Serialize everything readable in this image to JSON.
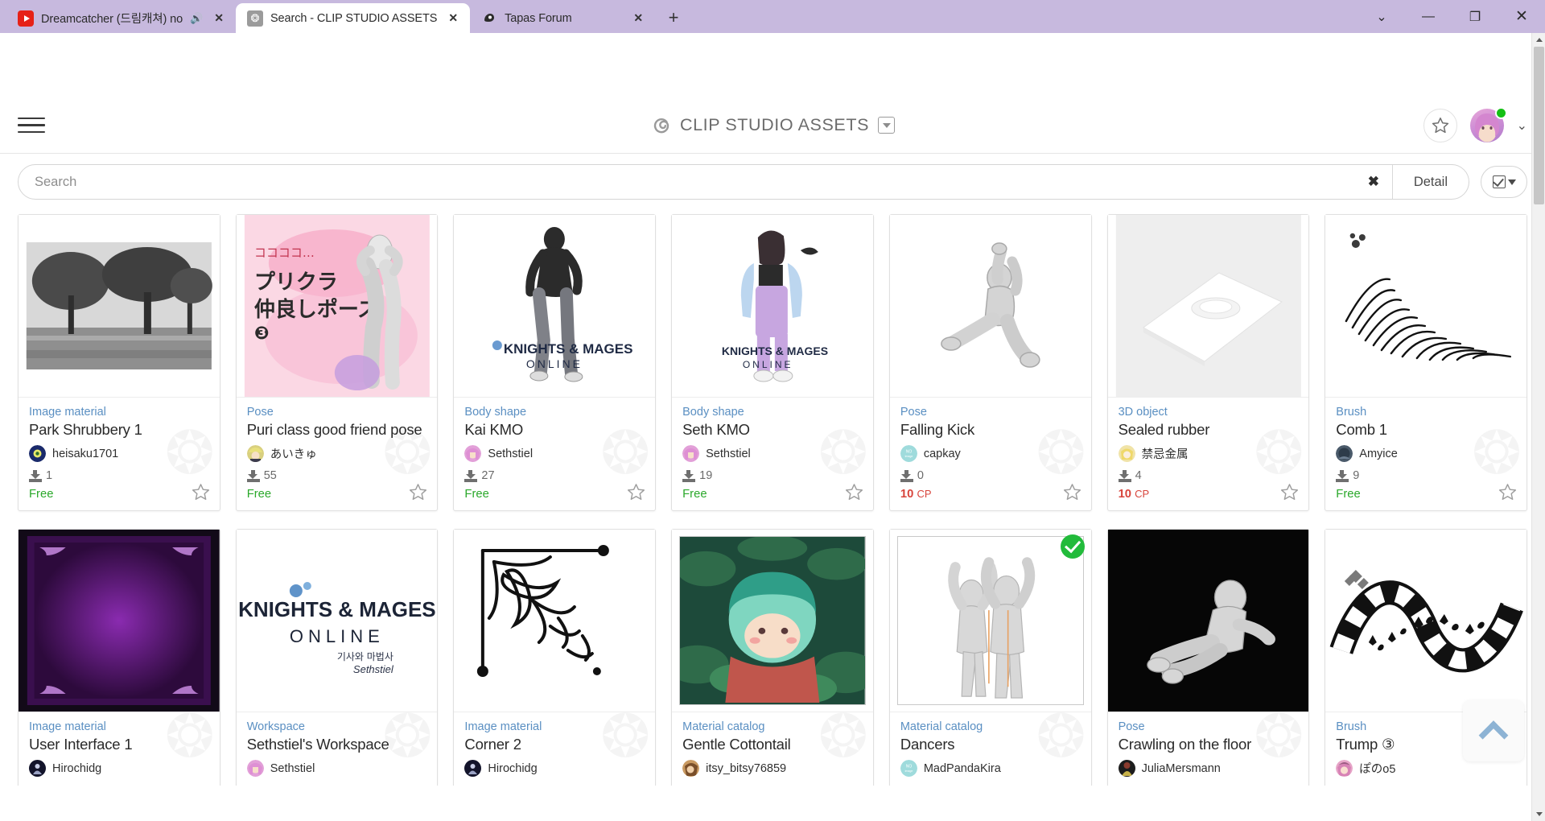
{
  "browser": {
    "tabs": [
      {
        "title": "Dreamcatcher (드림캐쳐) no",
        "favicon": "youtube-icon",
        "active": false,
        "audio": true,
        "close_label": "✕"
      },
      {
        "title": "Search - CLIP STUDIO ASSETS",
        "favicon": "clip-studio-assets-icon",
        "active": true,
        "audio": false,
        "close_label": "✕"
      },
      {
        "title": "Tapas Forum",
        "favicon": "tapas-icon",
        "active": false,
        "audio": false,
        "close_label": "✕"
      }
    ],
    "new_tab_label": "+",
    "window_controls": {
      "more": "⌄",
      "minimize": "—",
      "maximize": "❐",
      "close": "✕"
    }
  },
  "header": {
    "menu_icon": "hamburger-icon",
    "brand": "CLIP STUDIO ASSETS",
    "brand_mark": "clip-studio-swirl-icon",
    "brand_caret": "chevron-down-icon",
    "favorites_icon": "star-icon",
    "account_caret": "chevron-down-icon",
    "status": "online"
  },
  "search": {
    "placeholder": "Search",
    "value": "",
    "clear_label": "✖",
    "detail_label": "Detail",
    "view_toggle_icon": "checkbox-dropdown-icon"
  },
  "results": {
    "cards": [
      {
        "category": "Image material",
        "title": "Park Shrubbery 1",
        "author": "heisaku1701",
        "downloads": "1",
        "price": "Free",
        "price_type": "free",
        "art": "park-photo",
        "stacked": false,
        "owned": false
      },
      {
        "category": "Pose",
        "title": "Puri class good friend pose",
        "author": "あいきゅ",
        "downloads": "55",
        "price": "Free",
        "price_type": "free",
        "art": "puri-pose",
        "stacked": false,
        "owned": false
      },
      {
        "category": "Body shape",
        "title": "Kai KMO",
        "author": "Sethstiel",
        "downloads": "27",
        "price": "Free",
        "price_type": "free",
        "art": "kai-kmo",
        "stacked": false,
        "owned": false
      },
      {
        "category": "Body shape",
        "title": "Seth KMO",
        "author": "Sethstiel",
        "downloads": "19",
        "price": "Free",
        "price_type": "free",
        "art": "seth-kmo",
        "stacked": false,
        "owned": false
      },
      {
        "category": "Pose",
        "title": "Falling Kick",
        "author": "capkay",
        "downloads": "0",
        "price": "10",
        "price_unit": "CP",
        "price_type": "cp",
        "art": "falling-kick",
        "stacked": false,
        "owned": false
      },
      {
        "category": "3D object",
        "title": "Sealed rubber",
        "author": "禁忌金属",
        "downloads": "4",
        "price": "10",
        "price_unit": "CP",
        "price_type": "cp",
        "art": "sealed-rubber",
        "stacked": false,
        "owned": false
      },
      {
        "category": "Brush",
        "title": "Comb 1",
        "author": "Amyice",
        "downloads": "9",
        "price": "Free",
        "price_type": "free",
        "art": "comb-brush",
        "stacked": false,
        "owned": false
      },
      {
        "category": "Image material",
        "title": "User Interface 1",
        "author": "Hirochidg",
        "downloads": "",
        "price": "",
        "price_type": "none",
        "art": "ui-purple",
        "stacked": false,
        "owned": false
      },
      {
        "category": "Workspace",
        "title": "Sethstiel's Workspace",
        "author": "Sethstiel",
        "downloads": "",
        "price": "",
        "price_type": "none",
        "art": "knights-mages",
        "stacked": false,
        "owned": false
      },
      {
        "category": "Image material",
        "title": "Corner 2",
        "author": "Hirochidg",
        "downloads": "",
        "price": "",
        "price_type": "none",
        "art": "corner-ornament",
        "stacked": false,
        "owned": false
      },
      {
        "category": "Material catalog",
        "title": "Gentle Cottontail",
        "author": "itsy_bitsy76859",
        "downloads": "",
        "price": "",
        "price_type": "none",
        "art": "cottontail",
        "stacked": true,
        "owned": false
      },
      {
        "category": "Material catalog",
        "title": "Dancers",
        "author": "MadPandaKira",
        "downloads": "",
        "price": "",
        "price_type": "none",
        "art": "dancers",
        "stacked": true,
        "owned": true
      },
      {
        "category": "Pose",
        "title": "Crawling on the floor",
        "author": "JuliaMersmann",
        "downloads": "",
        "price": "",
        "price_type": "none",
        "art": "crawling",
        "stacked": false,
        "owned": false
      },
      {
        "category": "Brush",
        "title": "Trump ③",
        "author": "ぽのo5",
        "downloads": "",
        "price": "",
        "price_type": "none",
        "art": "trump-brush",
        "stacked": false,
        "owned": false
      }
    ],
    "scroll_to_top_icon": "chevron-up-icon"
  },
  "colors": {
    "chrome": "#c7b9de",
    "category_link": "#5a8fc2",
    "free": "#2aa82a",
    "cp": "#d8453c",
    "owned_badge": "#22bb3b",
    "to_top_arrow": "#8db3d4"
  }
}
